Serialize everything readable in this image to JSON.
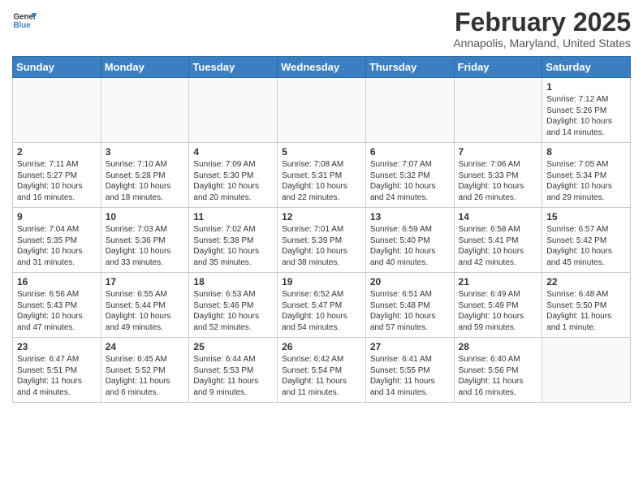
{
  "header": {
    "logo_general": "General",
    "logo_blue": "Blue",
    "title": "February 2025",
    "subtitle": "Annapolis, Maryland, United States"
  },
  "days_of_week": [
    "Sunday",
    "Monday",
    "Tuesday",
    "Wednesday",
    "Thursday",
    "Friday",
    "Saturday"
  ],
  "weeks": [
    [
      {
        "day": "",
        "info": ""
      },
      {
        "day": "",
        "info": ""
      },
      {
        "day": "",
        "info": ""
      },
      {
        "day": "",
        "info": ""
      },
      {
        "day": "",
        "info": ""
      },
      {
        "day": "",
        "info": ""
      },
      {
        "day": "1",
        "info": "Sunrise: 7:12 AM\nSunset: 5:26 PM\nDaylight: 10 hours\nand 14 minutes."
      }
    ],
    [
      {
        "day": "2",
        "info": "Sunrise: 7:11 AM\nSunset: 5:27 PM\nDaylight: 10 hours\nand 16 minutes."
      },
      {
        "day": "3",
        "info": "Sunrise: 7:10 AM\nSunset: 5:28 PM\nDaylight: 10 hours\nand 18 minutes."
      },
      {
        "day": "4",
        "info": "Sunrise: 7:09 AM\nSunset: 5:30 PM\nDaylight: 10 hours\nand 20 minutes."
      },
      {
        "day": "5",
        "info": "Sunrise: 7:08 AM\nSunset: 5:31 PM\nDaylight: 10 hours\nand 22 minutes."
      },
      {
        "day": "6",
        "info": "Sunrise: 7:07 AM\nSunset: 5:32 PM\nDaylight: 10 hours\nand 24 minutes."
      },
      {
        "day": "7",
        "info": "Sunrise: 7:06 AM\nSunset: 5:33 PM\nDaylight: 10 hours\nand 26 minutes."
      },
      {
        "day": "8",
        "info": "Sunrise: 7:05 AM\nSunset: 5:34 PM\nDaylight: 10 hours\nand 29 minutes."
      }
    ],
    [
      {
        "day": "9",
        "info": "Sunrise: 7:04 AM\nSunset: 5:35 PM\nDaylight: 10 hours\nand 31 minutes."
      },
      {
        "day": "10",
        "info": "Sunrise: 7:03 AM\nSunset: 5:36 PM\nDaylight: 10 hours\nand 33 minutes."
      },
      {
        "day": "11",
        "info": "Sunrise: 7:02 AM\nSunset: 5:38 PM\nDaylight: 10 hours\nand 35 minutes."
      },
      {
        "day": "12",
        "info": "Sunrise: 7:01 AM\nSunset: 5:39 PM\nDaylight: 10 hours\nand 38 minutes."
      },
      {
        "day": "13",
        "info": "Sunrise: 6:59 AM\nSunset: 5:40 PM\nDaylight: 10 hours\nand 40 minutes."
      },
      {
        "day": "14",
        "info": "Sunrise: 6:58 AM\nSunset: 5:41 PM\nDaylight: 10 hours\nand 42 minutes."
      },
      {
        "day": "15",
        "info": "Sunrise: 6:57 AM\nSunset: 5:42 PM\nDaylight: 10 hours\nand 45 minutes."
      }
    ],
    [
      {
        "day": "16",
        "info": "Sunrise: 6:56 AM\nSunset: 5:43 PM\nDaylight: 10 hours\nand 47 minutes."
      },
      {
        "day": "17",
        "info": "Sunrise: 6:55 AM\nSunset: 5:44 PM\nDaylight: 10 hours\nand 49 minutes."
      },
      {
        "day": "18",
        "info": "Sunrise: 6:53 AM\nSunset: 5:46 PM\nDaylight: 10 hours\nand 52 minutes."
      },
      {
        "day": "19",
        "info": "Sunrise: 6:52 AM\nSunset: 5:47 PM\nDaylight: 10 hours\nand 54 minutes."
      },
      {
        "day": "20",
        "info": "Sunrise: 6:51 AM\nSunset: 5:48 PM\nDaylight: 10 hours\nand 57 minutes."
      },
      {
        "day": "21",
        "info": "Sunrise: 6:49 AM\nSunset: 5:49 PM\nDaylight: 10 hours\nand 59 minutes."
      },
      {
        "day": "22",
        "info": "Sunrise: 6:48 AM\nSunset: 5:50 PM\nDaylight: 11 hours\nand 1 minute."
      }
    ],
    [
      {
        "day": "23",
        "info": "Sunrise: 6:47 AM\nSunset: 5:51 PM\nDaylight: 11 hours\nand 4 minutes."
      },
      {
        "day": "24",
        "info": "Sunrise: 6:45 AM\nSunset: 5:52 PM\nDaylight: 11 hours\nand 6 minutes."
      },
      {
        "day": "25",
        "info": "Sunrise: 6:44 AM\nSunset: 5:53 PM\nDaylight: 11 hours\nand 9 minutes."
      },
      {
        "day": "26",
        "info": "Sunrise: 6:42 AM\nSunset: 5:54 PM\nDaylight: 11 hours\nand 11 minutes."
      },
      {
        "day": "27",
        "info": "Sunrise: 6:41 AM\nSunset: 5:55 PM\nDaylight: 11 hours\nand 14 minutes."
      },
      {
        "day": "28",
        "info": "Sunrise: 6:40 AM\nSunset: 5:56 PM\nDaylight: 11 hours\nand 16 minutes."
      },
      {
        "day": "",
        "info": ""
      }
    ]
  ]
}
